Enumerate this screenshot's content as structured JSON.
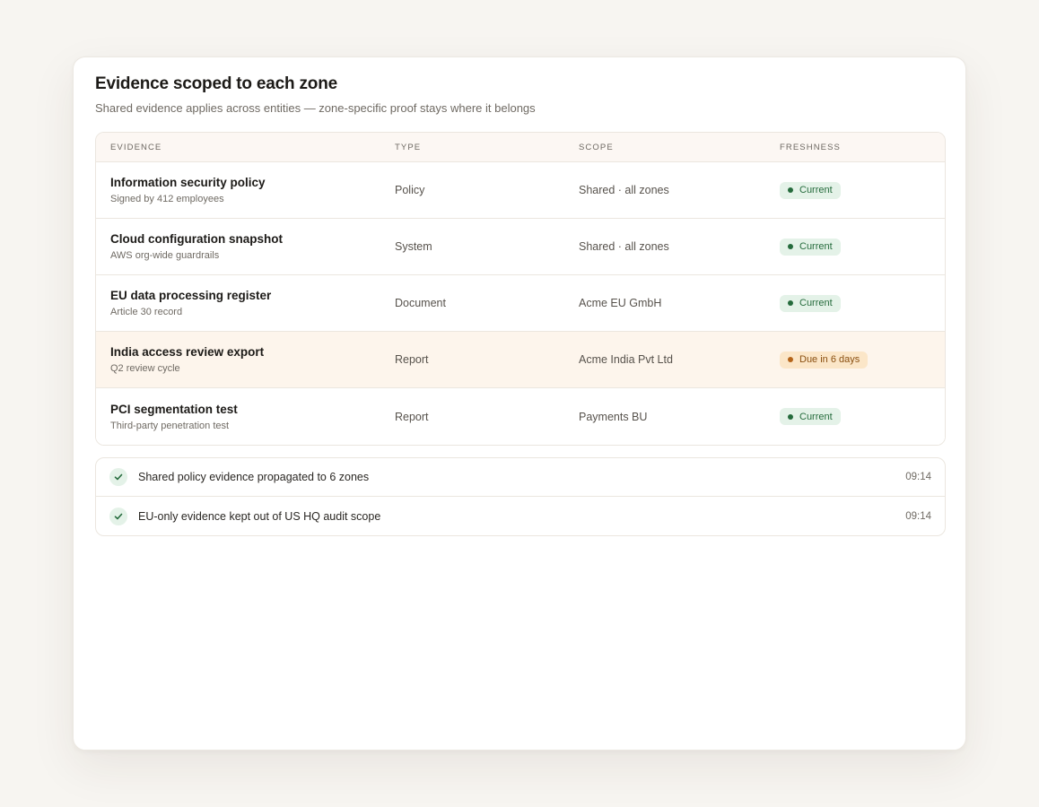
{
  "header": {
    "title": "Evidence scoped to each zone",
    "subtitle": "Shared evidence applies across entities — zone-specific proof stays where it belongs"
  },
  "table": {
    "columns": [
      "EVIDENCE",
      "TYPE",
      "SCOPE",
      "FRESHNESS"
    ],
    "rows": [
      {
        "name": "Information security policy",
        "detail": "Signed by 412 employees",
        "type": "Policy",
        "scope": "Shared · all zones",
        "freshness": "Current",
        "status": "current"
      },
      {
        "name": "Cloud configuration snapshot",
        "detail": "AWS org-wide guardrails",
        "type": "System",
        "scope": "Shared · all zones",
        "freshness": "Current",
        "status": "current"
      },
      {
        "name": "EU data processing register",
        "detail": "Article 30 record",
        "type": "Document",
        "scope": "Acme EU GmbH",
        "freshness": "Current",
        "status": "current"
      },
      {
        "name": "India access review export",
        "detail": "Q2 review cycle",
        "type": "Report",
        "scope": "Acme India Pvt Ltd",
        "freshness": "Due in 6 days",
        "status": "due"
      },
      {
        "name": "PCI segmentation test",
        "detail": "Third-party penetration test",
        "type": "Report",
        "scope": "Payments BU",
        "freshness": "Current",
        "status": "current"
      }
    ]
  },
  "activity": [
    {
      "text": "Shared policy evidence propagated to 6 zones",
      "time": "09:14",
      "icon": "check-icon"
    },
    {
      "text": "EU-only evidence kept out of US HQ audit scope",
      "time": "09:14",
      "icon": "check-icon"
    }
  ],
  "colors": {
    "current_bg": "#e4f2e8",
    "current_fg": "#256b3c",
    "due_bg": "#fbe6c8",
    "due_fg": "#8a4f10",
    "highlight_row": "#fdf5ec"
  }
}
